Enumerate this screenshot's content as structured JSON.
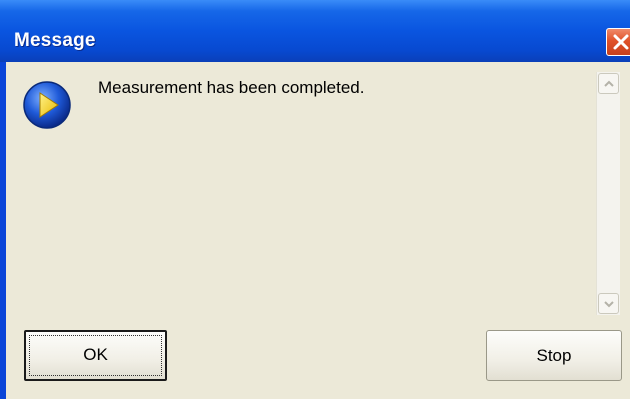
{
  "window": {
    "title": "Message"
  },
  "message": {
    "text": "Measurement has been completed.",
    "icon": "play-info-icon"
  },
  "buttons": {
    "ok_label": "OK",
    "stop_label": "Stop"
  },
  "colors": {
    "titlebar": "#0a55e0",
    "client_background": "#ece9d8",
    "close_button": "#e0522a"
  }
}
